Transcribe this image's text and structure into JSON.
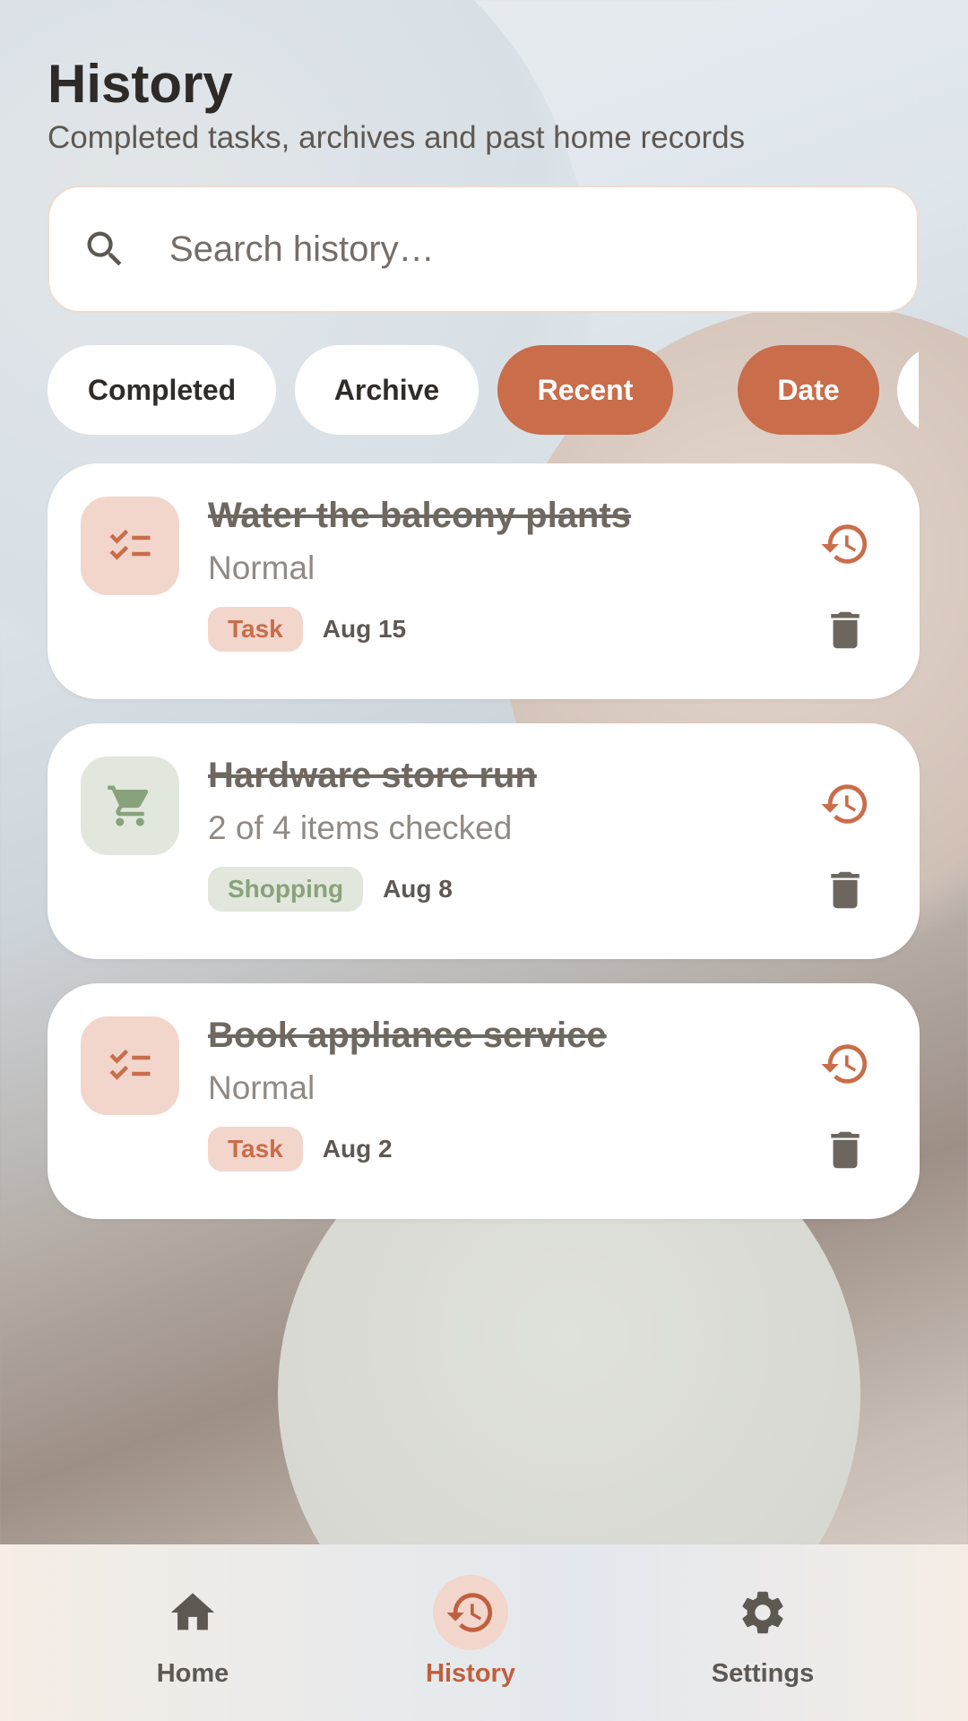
{
  "header": {
    "title": "History",
    "subtitle": "Completed tasks, archives and past home records"
  },
  "search": {
    "placeholder": "Search history…",
    "icon": "search-icon"
  },
  "filters": [
    {
      "label": "Completed",
      "active": false
    },
    {
      "label": "Archive",
      "active": false
    },
    {
      "label": "Recent",
      "active": true
    },
    {
      "label": "Date",
      "active": true
    }
  ],
  "colors": {
    "accent": "#c96d4a",
    "task_tag_bg": "#f2d6cc",
    "shopping_tag_bg": "#e1e7dc",
    "shopping_tag_text": "#89a27c"
  },
  "items": [
    {
      "title": "Water the balcony plants",
      "subtitle": "Normal",
      "tag": "Task",
      "date": "Aug 15",
      "icon": "checklist-icon",
      "kind": "task"
    },
    {
      "title": "Hardware store run",
      "subtitle": "2 of 4 items checked",
      "tag": "Shopping",
      "date": "Aug 8",
      "icon": "cart-icon",
      "kind": "shopping"
    },
    {
      "title": "Book appliance service",
      "subtitle": "Normal",
      "tag": "Task",
      "date": "Aug 2",
      "icon": "checklist-icon",
      "kind": "task"
    }
  ],
  "nav": [
    {
      "label": "Home",
      "icon": "home-icon",
      "active": false
    },
    {
      "label": "History",
      "icon": "history-icon",
      "active": true
    },
    {
      "label": "Settings",
      "icon": "gear-icon",
      "active": false
    }
  ]
}
